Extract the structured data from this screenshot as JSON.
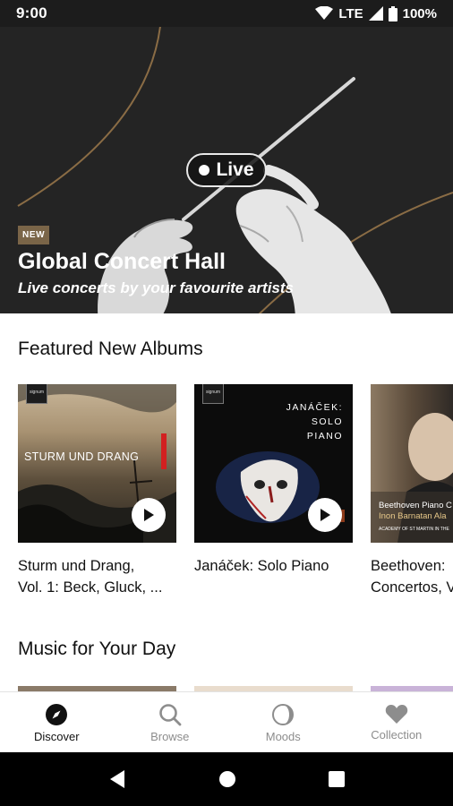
{
  "status_bar": {
    "time": "9:00",
    "network": "LTE",
    "battery": "100%"
  },
  "hero": {
    "live_label": "Live",
    "badge": "NEW",
    "title": "Global Concert Hall",
    "subtitle": "Live concerts by your favourite artists"
  },
  "featured": {
    "title": "Featured New Albums",
    "albums": [
      {
        "title_line1": "Sturm und Drang,",
        "title_line2": "Vol. 1: Beck, Gluck, ...",
        "cover_text": "STURM UND DRANG",
        "label_logo": "signum classics"
      },
      {
        "title_line1": "Janáček: Solo Piano",
        "title_line2": "",
        "cover_text_1": "JANÁČEK:",
        "cover_text_2": "SOLO",
        "cover_text_3": "PIANO",
        "label_logo": "signum classics"
      },
      {
        "title_line1": "Beethoven:",
        "title_line2": "Concertos, V",
        "cover_text_1": "Beethoven Piano C",
        "cover_text_2": "Inon Barnatan Ala",
        "cover_text_3": "ACADEMY OF ST MARTIN IN THE"
      }
    ]
  },
  "music_for_day": {
    "title": "Music for Your Day"
  },
  "bottom_nav": {
    "items": [
      {
        "label": "Discover",
        "icon": "compass-icon",
        "active": true
      },
      {
        "label": "Browse",
        "icon": "search-icon",
        "active": false
      },
      {
        "label": "Moods",
        "icon": "moon-icon",
        "active": false
      },
      {
        "label": "Collection",
        "icon": "heart-icon",
        "active": false
      }
    ]
  },
  "colors": {
    "accent_badge": "#7a6548",
    "hero_bg": "#242424",
    "nav_active": "#111111",
    "nav_inactive": "#8d8d8d"
  }
}
